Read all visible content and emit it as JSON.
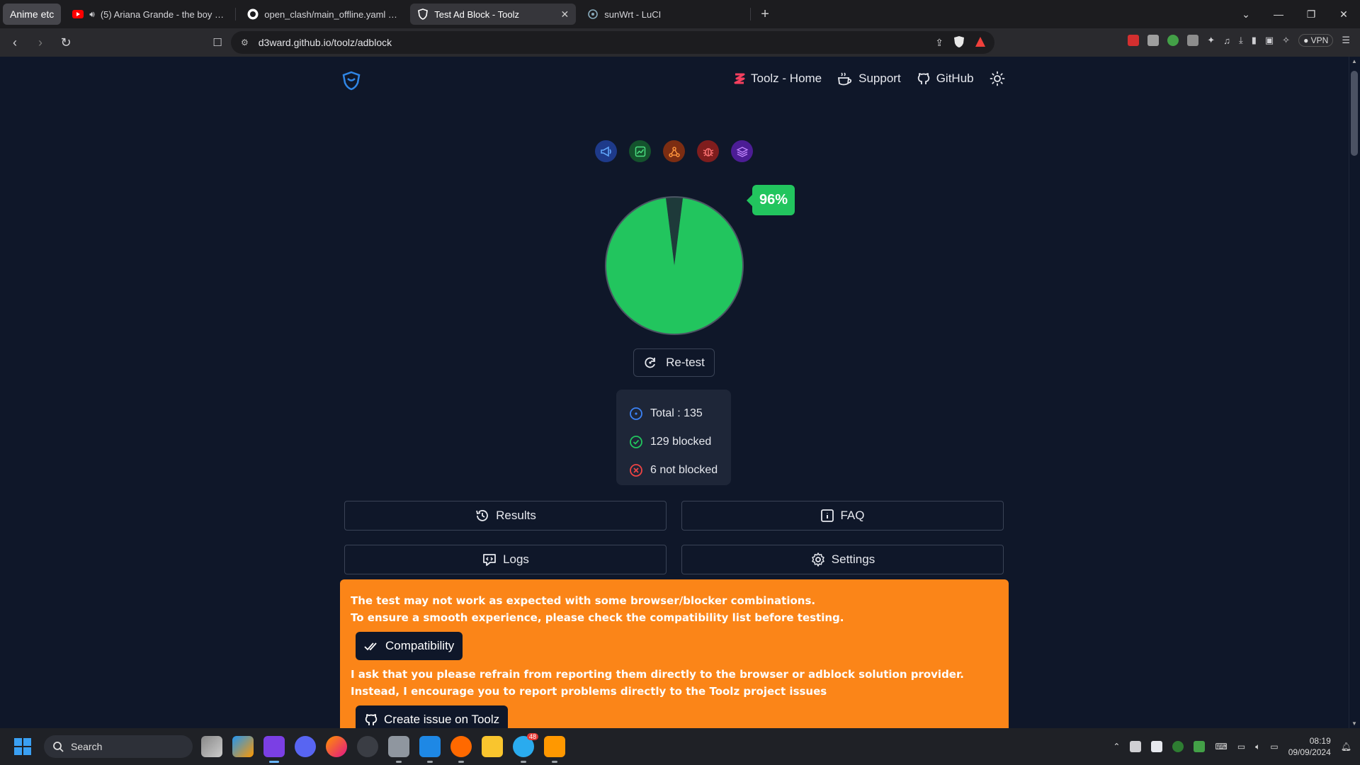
{
  "browser": {
    "profile_label": "Anime etc",
    "tabs": [
      {
        "title": "(5) Ariana Grande - the boy is m",
        "active": false
      },
      {
        "title": "open_clash/main_offline.yaml at ma",
        "active": false
      },
      {
        "title": "Test Ad Block - Toolz",
        "active": true
      },
      {
        "title": "sunWrt - LuCI",
        "active": false
      }
    ],
    "url": "d3ward.github.io/toolz/adblock",
    "vpn_label": "VPN"
  },
  "site": {
    "nav": {
      "home": "Toolz - Home",
      "support": "Support",
      "github": "GitHub"
    },
    "score": {
      "percent_label": "96%",
      "blocked_fraction": 0.96
    },
    "retest_label": "Re-test",
    "stats": {
      "total": "Total : 135",
      "blocked": "129 blocked",
      "not_blocked": "6 not blocked"
    },
    "buttons": {
      "results": "Results",
      "faq": "FAQ",
      "logs": "Logs",
      "settings": "Settings"
    },
    "alert": {
      "line1": "The test may not work as expected with some browser/blocker combinations.",
      "line2": "To ensure a smooth experience, please check the compatibility list before testing.",
      "compat_button": "Compatibility",
      "line3": "I ask that you please refrain from reporting them directly to the browser or adblock solution provider.",
      "line4": "Instead, I encourage you to report problems directly to the Toolz project issues",
      "issue_button": "Create issue on Toolz"
    },
    "colors": {
      "accent_green": "#22c55e",
      "alert_orange": "#fb8518",
      "background": "#0f1729"
    }
  },
  "taskbar": {
    "search_label": "Search",
    "time": "08:19",
    "date": "09/09/2024",
    "telegram_badge": "48"
  }
}
